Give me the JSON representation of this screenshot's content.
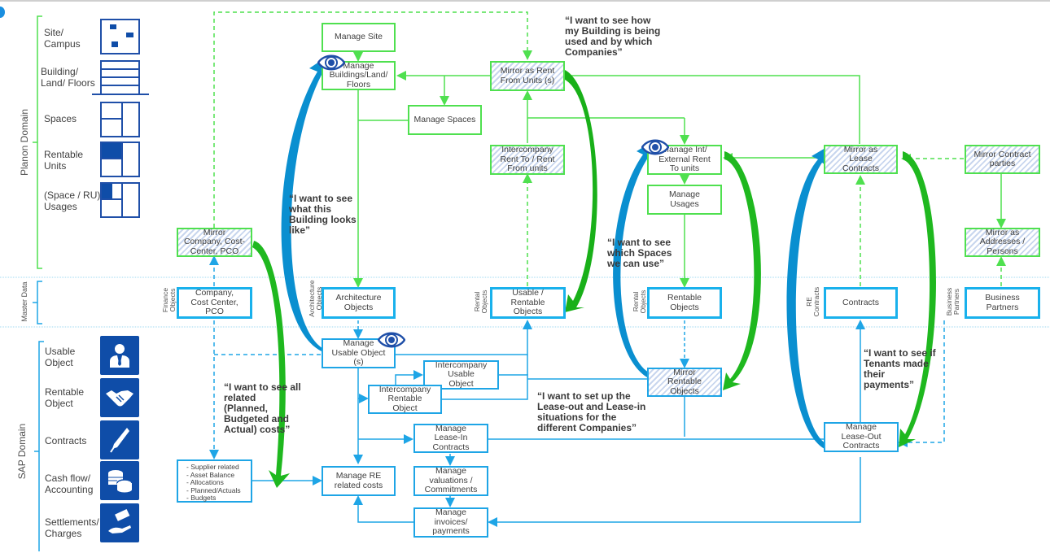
{
  "domains": {
    "planon": "Planon Domain",
    "master": "Master Data",
    "sap": "SAP Domain"
  },
  "legend_planon": [
    {
      "label": "Site/\nCampus",
      "icon": "site-campus-icon"
    },
    {
      "label": "Building/\nLand/ Floors",
      "icon": "building-floors-icon"
    },
    {
      "label": "Spaces",
      "icon": "spaces-icon"
    },
    {
      "label": "Rentable\nUnits",
      "icon": "rentable-units-icon"
    },
    {
      "label": "(Space / RU)\nUsages",
      "icon": "usages-icon"
    }
  ],
  "legend_sap": [
    {
      "label": "Usable\nObject",
      "icon": "person-tie-icon"
    },
    {
      "label": "Rentable\nObject",
      "icon": "handshake-icon"
    },
    {
      "label": "Contracts",
      "icon": "fountain-pen-icon"
    },
    {
      "label": "Cash flow/\nAccounting",
      "icon": "coins-icon"
    },
    {
      "label": "Settlements/\nCharges",
      "icon": "hand-money-icon"
    }
  ],
  "category_labels": {
    "finance": "Finance\nObjects",
    "architecture": "Architecture\nObjects",
    "rental1": "Rental\nObjects",
    "rental2": "Rental\nObjects",
    "re_contracts": "RE\nContracts",
    "business_partners": "Business\nPartners"
  },
  "planon_boxes": {
    "manage_site": "Manage Site",
    "manage_buildings": "Manage Buildings/Land/ Floors",
    "manage_spaces": "Manage Spaces",
    "mirror_rent_from": "Mirror as Rent From Units (s)",
    "intercompany_rent": "Intercompany Rent To / Rent From units",
    "manage_int_ext_rent": "Manage Int/ External Rent To units",
    "manage_usages": "Manage Usages",
    "mirror_lease_contracts": "Mirror as Lease Contracts",
    "mirror_contract_parties": "Mirror Contract parties",
    "mirror_addresses": "Mirror as Addresses / Persons",
    "mirror_company": "Mirror Company, Cost-Center, PCO"
  },
  "master_boxes": {
    "company": "Company, Cost Center, PCO",
    "architecture": "Architecture Objects",
    "usable_rentable": "Usable / Rentable Objects",
    "rentable": "Rentable Objects",
    "contracts": "Contracts",
    "business_partners": "Business Partners"
  },
  "sap_boxes": {
    "manage_usable": "Manage Usable Object (s)",
    "ic_usable": "Intercompany Usable Object",
    "ic_rentable": "Intercompany Rentable Object",
    "mirror_rentable": "Mirror Rentable Objects",
    "lease_in": "Manage Lease-In Contracts",
    "valuations": "Manage valuations / Commitments",
    "invoices": "Manage invoices/ payments",
    "re_costs": "Manage RE related costs",
    "lease_out": "Manage Lease-Out Contracts"
  },
  "cost_list": [
    "- Supplier related",
    "- Asset Balance",
    "- Allocations",
    "- Planned/Actuals",
    "- Budgets"
  ],
  "quotes": {
    "building_usage": "“I want to see how my Building is being used and by which Companies”",
    "building_looks": "“I want to see what this Building looks like”",
    "spaces_use": "“I want to see which Spaces we can use”",
    "costs": "“I want to see all related (Planned, Budgeted and Actual) costs”",
    "lease_setup": "“I want to set up the Lease-out and Lease-in situations for the different Companies”",
    "tenants": "“I want to see if Tenants made their payments”"
  },
  "colors": {
    "planon_green": "#4fe04f",
    "sap_blue": "#1ea5e6",
    "dark_blue": "#0f4da8",
    "arrow_green": "#1fb81f",
    "arrow_blue": "#0a8fd0"
  }
}
